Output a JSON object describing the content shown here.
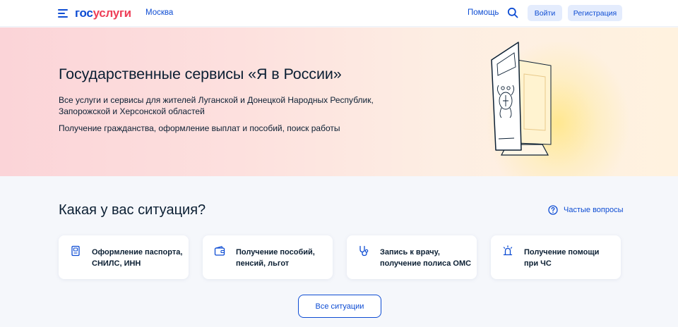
{
  "header": {
    "logo_part1": "гос",
    "logo_part2": "услуги",
    "city": "Москва",
    "help_label": "Помощь",
    "login_label": "Войти",
    "register_label": "Регистрация",
    "icons": {
      "menu": "burger-menu-icon",
      "search": "search-icon"
    }
  },
  "hero": {
    "title": "Государственные сервисы «Я в России»",
    "subtitle": "Все услуги и сервисы для жителей Луганской и Донецкой Народных Республик, Запорожской и Херсонской областей",
    "subtitle2": "Получение гражданства, оформление выплат и пособий, поиск работы",
    "illustration": "passport-coat-of-arms"
  },
  "situations": {
    "title": "Какая у вас ситуация?",
    "faq_label": "Частые вопросы",
    "cards": [
      {
        "label": "Оформление паспорта, СНИЛС, ИНН",
        "icon": "document-icon"
      },
      {
        "label": "Получение пособий, пенсий, льгот",
        "icon": "wallet-icon"
      },
      {
        "label": "Запись к врачу, получение полиса ОМС",
        "icon": "stethoscope-icon"
      },
      {
        "label": "Получение помощи при ЧС",
        "icon": "siren-icon"
      }
    ],
    "all_label": "Все ситуации"
  },
  "colors": {
    "brand_blue": "#0d4cd3",
    "brand_red": "#ee3f58",
    "text": "#0b1f33",
    "button_light": "#e4ecfd"
  }
}
